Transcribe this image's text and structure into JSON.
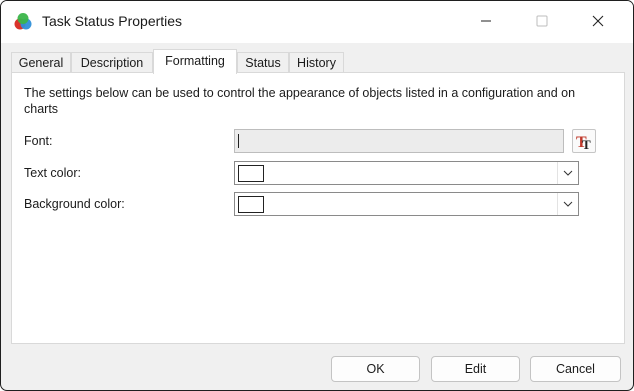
{
  "window": {
    "title": "Task Status Properties",
    "icon": "app-icon",
    "controls": {
      "minimize": "minimize-icon",
      "maximize": "maximize-icon",
      "close": "close-icon"
    }
  },
  "tabs": [
    {
      "label": "General",
      "active": false
    },
    {
      "label": "Description",
      "active": false
    },
    {
      "label": "Formatting",
      "active": true
    },
    {
      "label": "Status",
      "active": false
    },
    {
      "label": "History",
      "active": false
    }
  ],
  "formatting": {
    "description": "The settings below can be used to control the appearance of objects listed in a configuration and on charts",
    "font_label": "Font:",
    "font_value": "",
    "font_button_icon": "font-picker-icon",
    "text_color_label": "Text color:",
    "text_color_value": "#ffffff",
    "background_color_label": "Background color:",
    "background_color_value": "#ffffff"
  },
  "buttons": {
    "ok": "OK",
    "edit": "Edit",
    "cancel": "Cancel"
  },
  "colors": {
    "accent_red": "#c0392b",
    "window_bg": "#f0f0f0"
  }
}
